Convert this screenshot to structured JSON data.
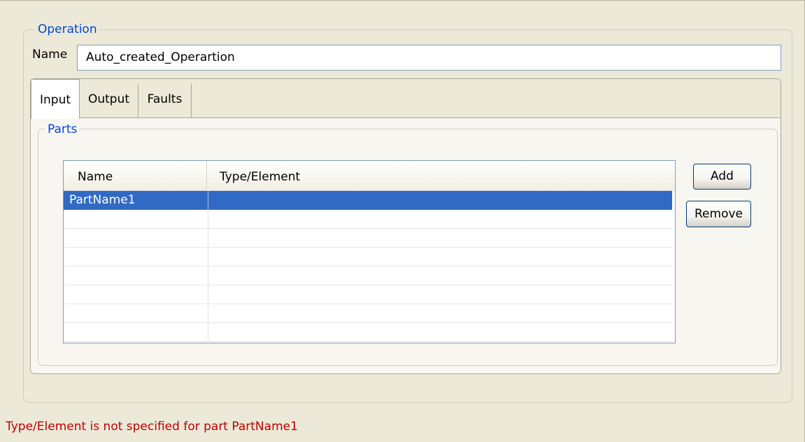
{
  "operation": {
    "group_label": "Operation",
    "name_label": "Name",
    "name_value": "Auto_created_Operartion"
  },
  "tabs": [
    {
      "label": "Input",
      "active": true
    },
    {
      "label": "Output",
      "active": false
    },
    {
      "label": "Faults",
      "active": false
    }
  ],
  "parts": {
    "group_label": "Parts",
    "columns": [
      "Name",
      "Type/Element"
    ],
    "rows": [
      {
        "name": "PartName1",
        "type": "",
        "selected": true
      },
      {
        "name": "",
        "type": ""
      },
      {
        "name": "",
        "type": ""
      },
      {
        "name": "",
        "type": ""
      },
      {
        "name": "",
        "type": ""
      },
      {
        "name": "",
        "type": ""
      },
      {
        "name": "",
        "type": ""
      },
      {
        "name": "",
        "type": ""
      }
    ],
    "add_label": "Add",
    "remove_label": "Remove"
  },
  "status": {
    "message": "Type/Element is not specified for part PartName1",
    "color": "#c00000"
  },
  "colors": {
    "selection": "#316ac5",
    "legend": "#0046d5",
    "background": "#ece9d8"
  }
}
